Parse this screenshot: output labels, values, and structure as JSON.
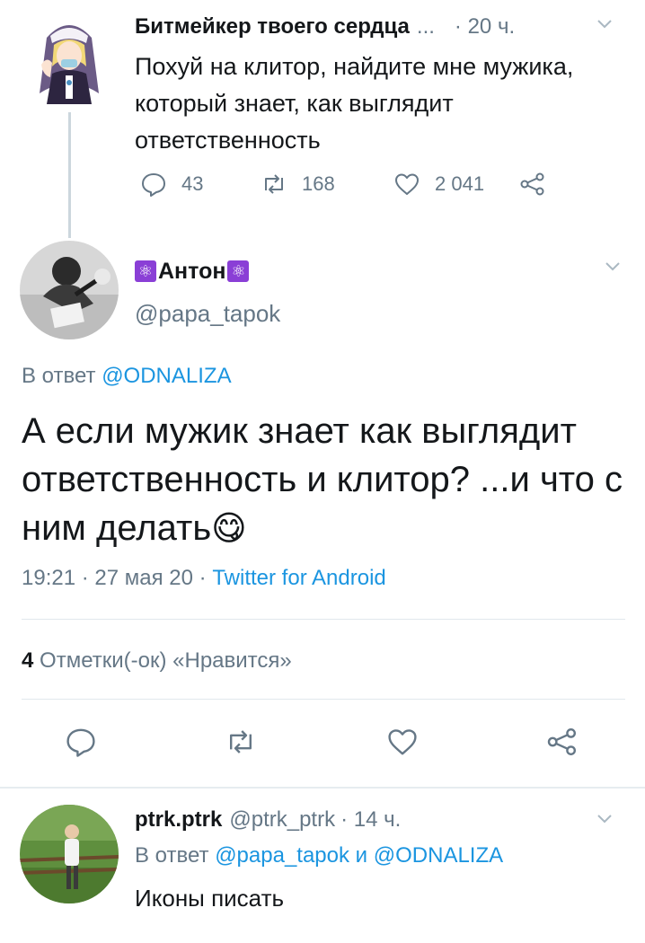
{
  "top_tweet": {
    "author_name": "Битмейкер твоего сердца",
    "ellipsis": "...",
    "time": "· 20 ч.",
    "text": "Похуй на клитор, найдите мне мужика, который знает, как выглядит ответственность",
    "actions": {
      "replies": "43",
      "retweets": "168",
      "likes": "2 041"
    }
  },
  "main_tweet": {
    "author_name": "Антон",
    "author_emoji_left": "⚛",
    "author_emoji_right": "⚛",
    "handle": "@papa_tapok",
    "reply_prefix": "В ответ",
    "reply_mention": "@ODNALIZA",
    "text": "А если мужик знает как выглядит ответственность и клитор? ...и что с ним делать",
    "emoji": "😋",
    "time": "19:21",
    "date": "27 мая 20",
    "source": "Twitter for Android",
    "likes_count": "4",
    "likes_label": "Отметки(-ок) «Нравится»"
  },
  "reply_tweet": {
    "author_name": "ptrk.ptrk",
    "handle": "@ptrk_ptrk",
    "time": "· 14 ч.",
    "reply_prefix": "В ответ",
    "mention_1": "@papa_tapok",
    "conjunction": "и",
    "mention_2": "@ODNALIZA",
    "text": "Иконы писать"
  },
  "colors": {
    "link": "#1b95e0",
    "muted": "#657786",
    "text": "#14171a",
    "divider": "#e1e8ed",
    "atom_badge": "#8a3fd6"
  }
}
